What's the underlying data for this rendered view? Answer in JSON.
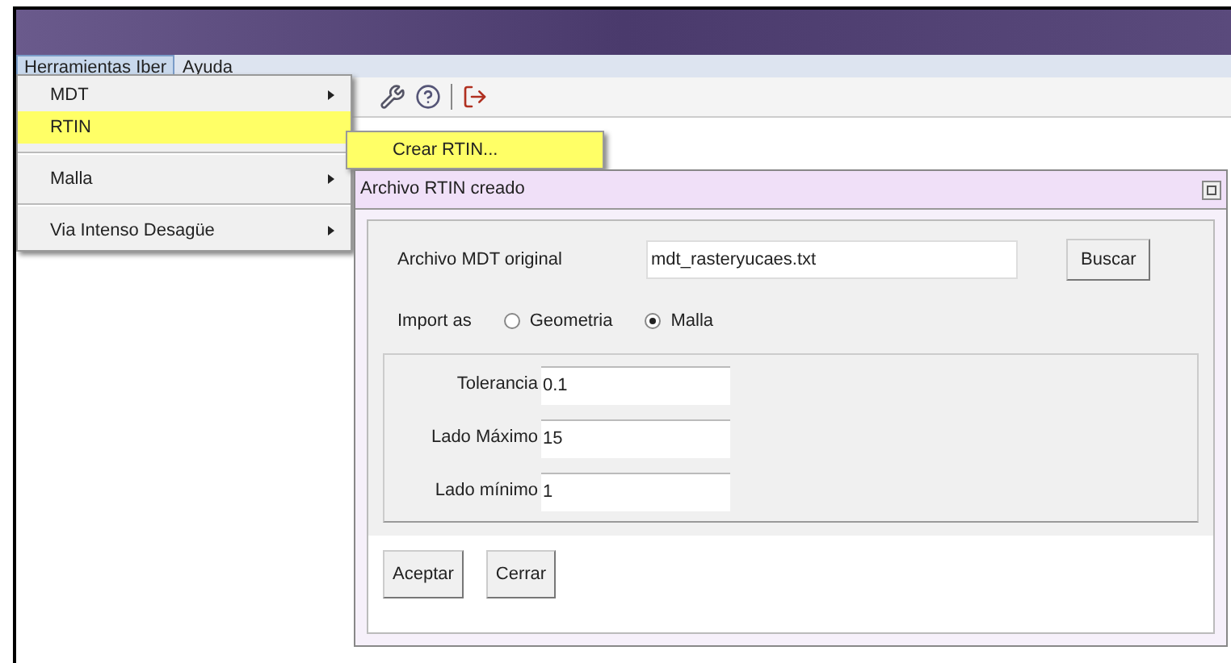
{
  "menubar": [
    {
      "label": "Herramientas Iber",
      "selected": true
    },
    {
      "label": "Ayuda",
      "selected": false
    }
  ],
  "menu": {
    "items": [
      {
        "label": "MDT",
        "highlighted": false,
        "has_submenu": true,
        "separator_after": false
      },
      {
        "label": "RTIN",
        "highlighted": true,
        "has_submenu": false,
        "separator_after": true
      },
      {
        "label": "Malla",
        "highlighted": false,
        "has_submenu": true,
        "separator_after": true
      },
      {
        "label": "Via Intenso Desagüe",
        "highlighted": false,
        "has_submenu": true,
        "separator_after": false
      }
    ]
  },
  "submenu": {
    "items": [
      {
        "label": "Crear RTIN...",
        "highlighted": true
      }
    ]
  },
  "dialog": {
    "title": "Archivo RTIN creado",
    "file": {
      "label": "Archivo MDT original",
      "value": "mdt_rasteryucaes.txt",
      "button": "Buscar"
    },
    "import_as": {
      "label": "Import as",
      "options": [
        {
          "label": "Geometria",
          "selected": false
        },
        {
          "label": "Malla",
          "selected": true
        }
      ]
    },
    "params": [
      {
        "label": "Tolerancia",
        "value": "0.1"
      },
      {
        "label": "Lado Máximo",
        "value": "15"
      },
      {
        "label": "Lado mínimo",
        "value": "1"
      }
    ],
    "buttons": [
      "Aceptar",
      "Cerrar"
    ]
  }
}
